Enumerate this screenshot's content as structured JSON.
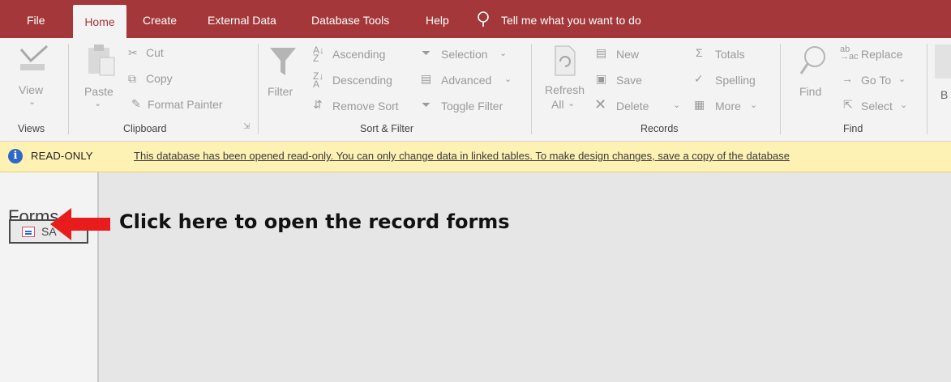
{
  "menu": {
    "file": "File",
    "home": "Home",
    "create": "Create",
    "external_data": "External Data",
    "database_tools": "Database Tools",
    "help": "Help",
    "tell_me": "Tell me what you want to do"
  },
  "ribbon": {
    "views": {
      "view": "View",
      "group": "Views"
    },
    "clipboard": {
      "paste": "Paste",
      "cut": "Cut",
      "copy": "Copy",
      "format_painter": "Format Painter",
      "group": "Clipboard"
    },
    "sort_filter": {
      "filter": "Filter",
      "ascending": "Ascending",
      "descending": "Descending",
      "remove_sort": "Remove Sort",
      "selection": "Selection",
      "advanced": "Advanced",
      "toggle_filter": "Toggle Filter",
      "group": "Sort & Filter"
    },
    "records": {
      "refresh": "Refresh",
      "refresh_all": "All",
      "new": "New",
      "save": "Save",
      "delete": "Delete",
      "totals": "Totals",
      "spelling": "Spelling",
      "more": "More",
      "group": "Records"
    },
    "find": {
      "find": "Find",
      "replace": "Replace",
      "goto": "Go To",
      "select": "Select",
      "group": "Find"
    },
    "cut_off_letter": "B"
  },
  "message_bar": {
    "label": "READ-ONLY",
    "text": "This database has been opened read-only. You can only change data in linked tables. To make design changes, save a copy of the database"
  },
  "nav_pane": {
    "heading": "Forms",
    "form_item": "SA"
  },
  "annotation": "Click here to open the record forms",
  "colors": {
    "accent": "#a4373a",
    "message_bar": "#fdf1b3",
    "arrow": "#e81c1c"
  }
}
